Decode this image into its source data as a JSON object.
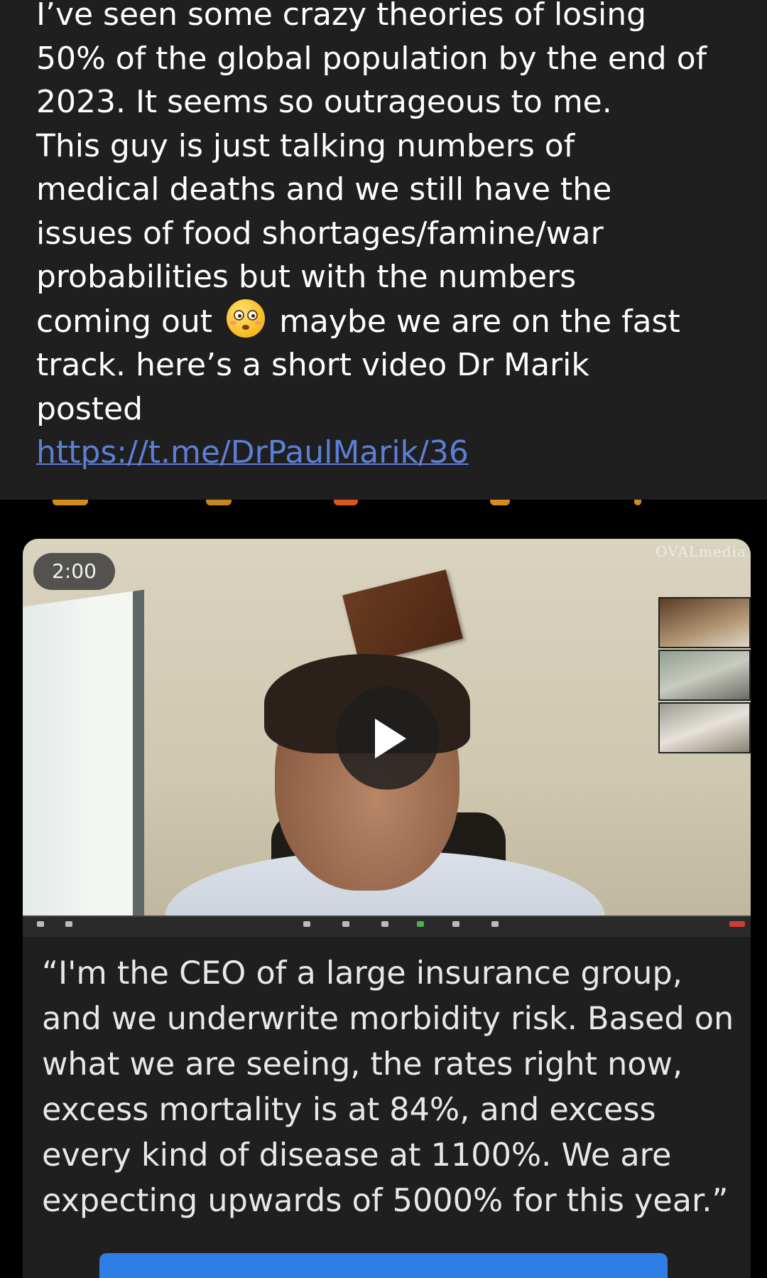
{
  "post": {
    "lines": [
      "I’ve seen some crazy theories of losing",
      "50% of the global population by the end of",
      "2023. It seems so outrageous to me.",
      "This guy is just talking numbers of",
      "medical deaths and we still have the",
      "issues of food shortages/famine/war",
      "probabilities but with the numbers",
      "coming out",
      "maybe we are on the fast",
      "track. here’s a short video Dr Marik",
      "posted"
    ],
    "emoji": "flushed-face-emoji",
    "link": "https://t.me/DrPaulMarik/36"
  },
  "video": {
    "duration": "2:00",
    "watermark": "OVALmedia"
  },
  "quote": {
    "lines": [
      "“I'm the CEO of a large insurance group,",
      "and we underwrite morbidity risk. Based on",
      "what we are seeing, the rates right now,",
      "excess mortality is at 84%, and excess",
      "every kind of disease at 1100%. We are",
      "expecting upwards of 5000% for this year.”"
    ]
  },
  "colors": {
    "background": "#000000",
    "panel": "#1f1f1f",
    "link": "#5c7fd6",
    "cta": "#2f7ee8"
  }
}
